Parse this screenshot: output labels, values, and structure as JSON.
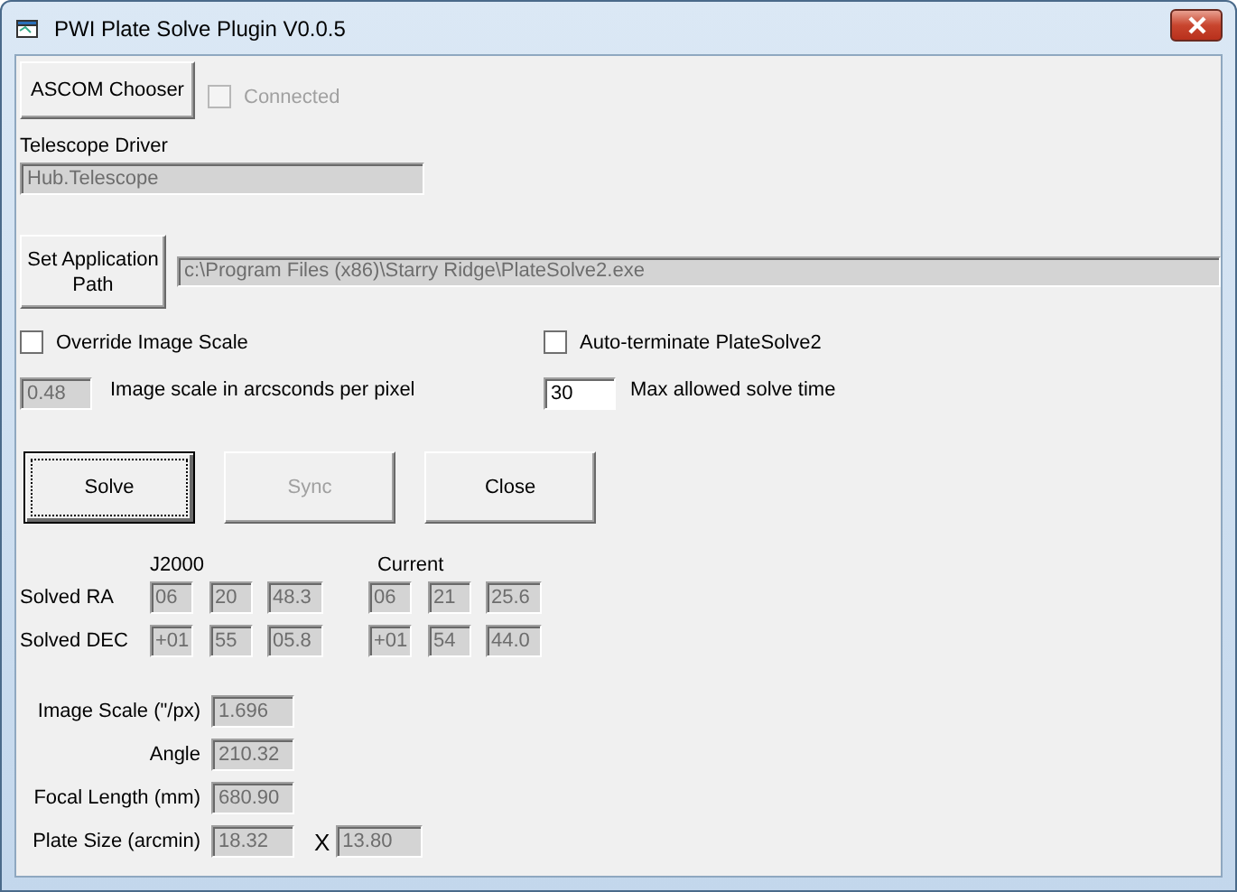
{
  "window": {
    "title": "PWI Plate Solve Plugin V0.0.5"
  },
  "ascom_button": {
    "label": "ASCOM Chooser"
  },
  "connected": {
    "label": "Connected",
    "checked": false,
    "disabled": true
  },
  "telescope_driver": {
    "label": "Telescope Driver",
    "value": "Hub.Telescope",
    "disabled": true
  },
  "app_path": {
    "button": "Set Application Path",
    "value": "c:\\Program Files (x86)\\Starry Ridge\\PlateSolve2.exe",
    "disabled": true
  },
  "override_scale": {
    "label": "Override Image Scale",
    "checked": false
  },
  "auto_terminate": {
    "label": "Auto-terminate PlateSolve2",
    "checked": false
  },
  "image_scale": {
    "value": "0.48",
    "label": "Image scale in arcsconds per pixel",
    "disabled": true
  },
  "max_time": {
    "value": "30",
    "label": "Max allowed solve time",
    "disabled": false
  },
  "buttons": [
    {
      "label": "Solve",
      "focused": true,
      "disabled": false
    },
    {
      "label": "Sync",
      "focused": false,
      "disabled": true
    },
    {
      "label": "Close",
      "focused": false,
      "disabled": false
    }
  ],
  "coords": {
    "columns": [
      "J2000",
      "Current"
    ],
    "rows": [
      {
        "label": "Solved RA",
        "j2000": [
          "06",
          "20",
          "48.3"
        ],
        "current": [
          "06",
          "21",
          "25.6"
        ]
      },
      {
        "label": "Solved DEC",
        "j2000": [
          "+01",
          "55",
          "05.8"
        ],
        "current": [
          "+01",
          "54",
          "44.0"
        ]
      }
    ]
  },
  "results": [
    {
      "label": "Image Scale (\"/px)",
      "values": [
        "1.696"
      ]
    },
    {
      "label": "Angle",
      "values": [
        "210.32"
      ]
    },
    {
      "label": "Focal Length (mm)",
      "values": [
        "680.90"
      ]
    },
    {
      "label": "Plate Size (arcmin)",
      "values": [
        "18.32",
        "13.80"
      ],
      "separator": "X"
    }
  ]
}
